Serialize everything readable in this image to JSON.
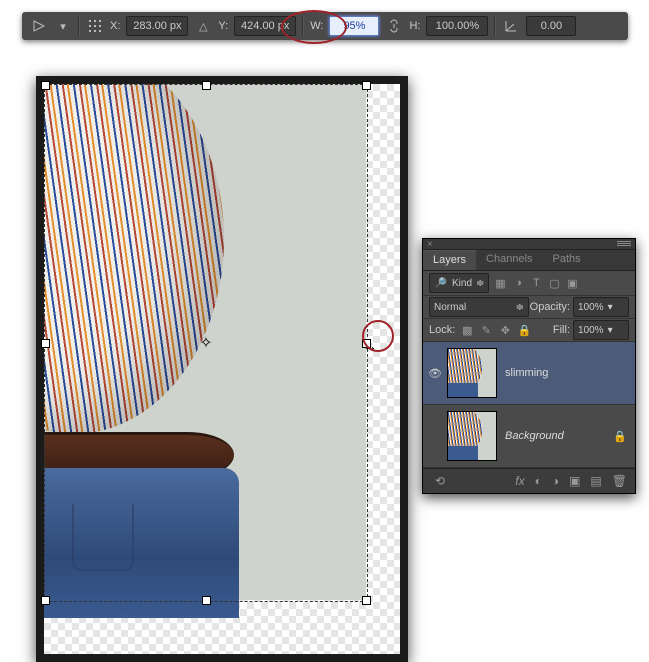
{
  "options_bar": {
    "reference_point_icon": "reference-point",
    "x_label": "X:",
    "x_value": "283.00 px",
    "y_icon": "triangle",
    "y_label": "Y:",
    "y_value": "424.00 px",
    "w_label": "W:",
    "w_value": "95%",
    "link_icon": "link",
    "h_label": "H:",
    "h_value": "100.00%",
    "angle_icon": "angle",
    "angle_value": "0.00"
  },
  "layers_panel": {
    "tabs": [
      "Layers",
      "Channels",
      "Paths"
    ],
    "filter_kind_icon": "search",
    "filter_kind_label": "Kind",
    "filter_icons": [
      "image-icon",
      "adjustment-icon",
      "type-icon",
      "shape-icon",
      "smartobj-icon"
    ],
    "blend_mode": "Normal",
    "opacity_label": "Opacity:",
    "opacity_value": "100%",
    "lock_label": "Lock:",
    "lock_icons": [
      "lock-transparent-icon",
      "lock-image-icon",
      "lock-position-icon",
      "lock-all-icon"
    ],
    "fill_label": "Fill:",
    "fill_value": "100%",
    "layers": [
      {
        "name": "slimming",
        "visible": true,
        "locked": false,
        "selected": true
      },
      {
        "name": "Background",
        "visible": false,
        "locked": true,
        "selected": false
      }
    ],
    "footer_icons": [
      "link-icon",
      "fx-icon",
      "mask-icon",
      "adjustment-layer-icon",
      "group-icon",
      "new-layer-icon",
      "trash-icon"
    ]
  },
  "canvas": {
    "bg_color": "#cfd3cd"
  }
}
